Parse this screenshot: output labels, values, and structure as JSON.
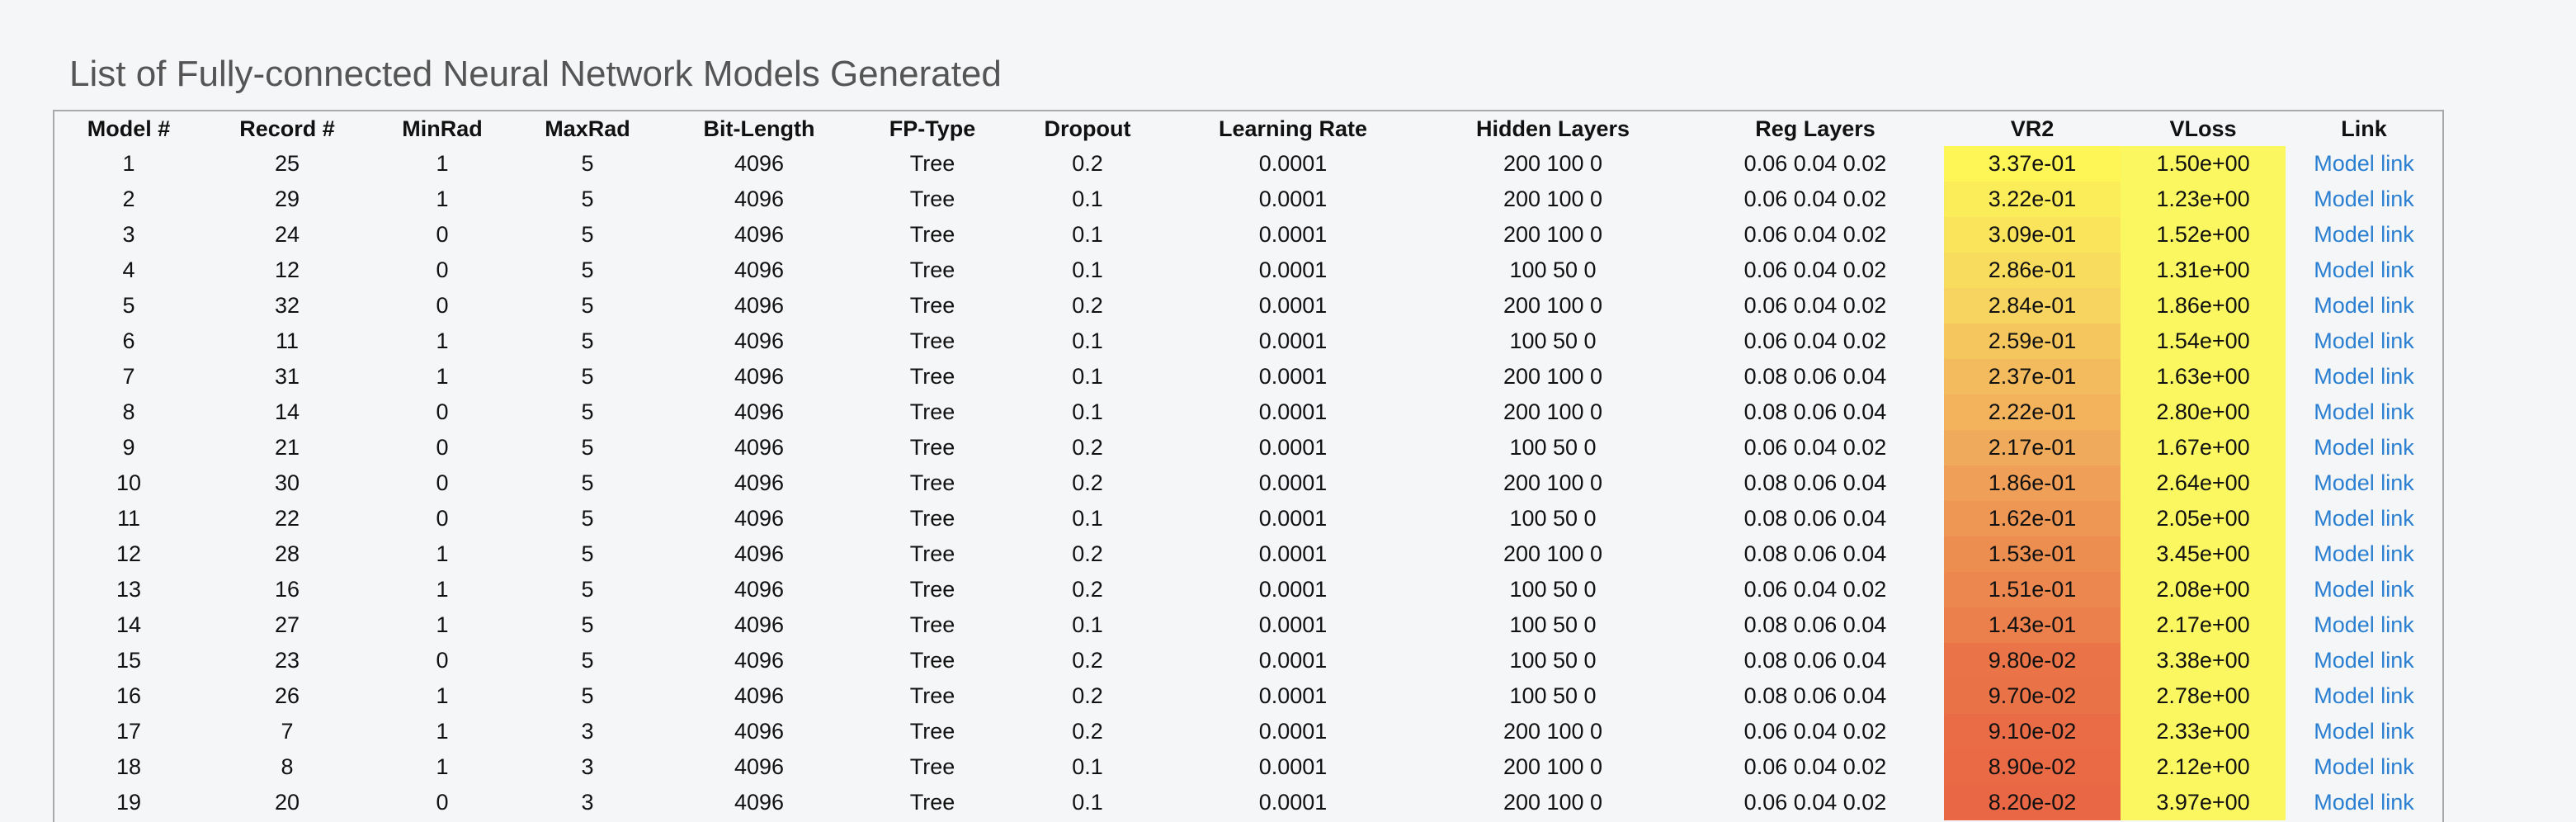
{
  "page": {
    "title": "List of Fully-connected Neural Network Models Generated"
  },
  "table": {
    "columns": [
      "Model #",
      "Record #",
      "MinRad",
      "MaxRad",
      "Bit-Length",
      "FP-Type",
      "Dropout",
      "Learning Rate",
      "Hidden Layers",
      "Reg Layers",
      "VR2",
      "VLoss",
      "Link"
    ],
    "link_label": "Model link",
    "colors": {
      "vr2_scale": [
        "#fdf656",
        "#fbed5a",
        "#fae45c",
        "#f8dc5e",
        "#f7d460",
        "#f5c65e",
        "#f3bb5d",
        "#f2b35c",
        "#f0aa5b",
        "#ef9f57",
        "#ee9654",
        "#ed8e51",
        "#ec874f",
        "#eb804c",
        "#ea7448",
        "#ea7247",
        "#e96c46",
        "#e96a45",
        "#e96744"
      ],
      "vloss_cell": "#fbf760",
      "link_text": "#2a7fd0"
    },
    "rows": [
      [
        "1",
        "25",
        "1",
        "5",
        "4096",
        "Tree",
        "0.2",
        "0.0001",
        "200 100 0",
        "0.06 0.04 0.02",
        "3.37e-01",
        "1.50e+00"
      ],
      [
        "2",
        "29",
        "1",
        "5",
        "4096",
        "Tree",
        "0.1",
        "0.0001",
        "200 100 0",
        "0.06 0.04 0.02",
        "3.22e-01",
        "1.23e+00"
      ],
      [
        "3",
        "24",
        "0",
        "5",
        "4096",
        "Tree",
        "0.1",
        "0.0001",
        "200 100 0",
        "0.06 0.04 0.02",
        "3.09e-01",
        "1.52e+00"
      ],
      [
        "4",
        "12",
        "0",
        "5",
        "4096",
        "Tree",
        "0.1",
        "0.0001",
        "100 50 0",
        "0.06 0.04 0.02",
        "2.86e-01",
        "1.31e+00"
      ],
      [
        "5",
        "32",
        "0",
        "5",
        "4096",
        "Tree",
        "0.2",
        "0.0001",
        "200 100 0",
        "0.06 0.04 0.02",
        "2.84e-01",
        "1.86e+00"
      ],
      [
        "6",
        "11",
        "1",
        "5",
        "4096",
        "Tree",
        "0.1",
        "0.0001",
        "100 50 0",
        "0.06 0.04 0.02",
        "2.59e-01",
        "1.54e+00"
      ],
      [
        "7",
        "31",
        "1",
        "5",
        "4096",
        "Tree",
        "0.1",
        "0.0001",
        "200 100 0",
        "0.08 0.06 0.04",
        "2.37e-01",
        "1.63e+00"
      ],
      [
        "8",
        "14",
        "0",
        "5",
        "4096",
        "Tree",
        "0.1",
        "0.0001",
        "200 100 0",
        "0.08 0.06 0.04",
        "2.22e-01",
        "2.80e+00"
      ],
      [
        "9",
        "21",
        "0",
        "5",
        "4096",
        "Tree",
        "0.2",
        "0.0001",
        "100 50 0",
        "0.06 0.04 0.02",
        "2.17e-01",
        "1.67e+00"
      ],
      [
        "10",
        "30",
        "0",
        "5",
        "4096",
        "Tree",
        "0.2",
        "0.0001",
        "200 100 0",
        "0.08 0.06 0.04",
        "1.86e-01",
        "2.64e+00"
      ],
      [
        "11",
        "22",
        "0",
        "5",
        "4096",
        "Tree",
        "0.1",
        "0.0001",
        "100 50 0",
        "0.08 0.06 0.04",
        "1.62e-01",
        "2.05e+00"
      ],
      [
        "12",
        "28",
        "1",
        "5",
        "4096",
        "Tree",
        "0.2",
        "0.0001",
        "200 100 0",
        "0.08 0.06 0.04",
        "1.53e-01",
        "3.45e+00"
      ],
      [
        "13",
        "16",
        "1",
        "5",
        "4096",
        "Tree",
        "0.2",
        "0.0001",
        "100 50 0",
        "0.06 0.04 0.02",
        "1.51e-01",
        "2.08e+00"
      ],
      [
        "14",
        "27",
        "1",
        "5",
        "4096",
        "Tree",
        "0.1",
        "0.0001",
        "100 50 0",
        "0.08 0.06 0.04",
        "1.43e-01",
        "2.17e+00"
      ],
      [
        "15",
        "23",
        "0",
        "5",
        "4096",
        "Tree",
        "0.2",
        "0.0001",
        "100 50 0",
        "0.08 0.06 0.04",
        "9.80e-02",
        "3.38e+00"
      ],
      [
        "16",
        "26",
        "1",
        "5",
        "4096",
        "Tree",
        "0.2",
        "0.0001",
        "100 50 0",
        "0.08 0.06 0.04",
        "9.70e-02",
        "2.78e+00"
      ],
      [
        "17",
        "7",
        "1",
        "3",
        "4096",
        "Tree",
        "0.2",
        "0.0001",
        "200 100 0",
        "0.06 0.04 0.02",
        "9.10e-02",
        "2.33e+00"
      ],
      [
        "18",
        "8",
        "1",
        "3",
        "4096",
        "Tree",
        "0.1",
        "0.0001",
        "200 100 0",
        "0.06 0.04 0.02",
        "8.90e-02",
        "2.12e+00"
      ],
      [
        "19",
        "20",
        "0",
        "3",
        "4096",
        "Tree",
        "0.1",
        "0.0001",
        "200 100 0",
        "0.06 0.04 0.02",
        "8.20e-02",
        "3.97e+00"
      ]
    ]
  }
}
